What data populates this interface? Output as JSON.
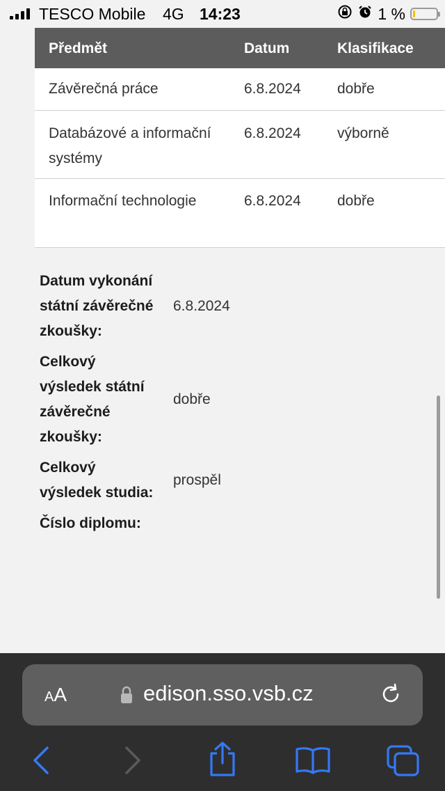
{
  "status_bar": {
    "carrier": "TESCO Mobile",
    "network": "4G",
    "time": "14:23",
    "battery_percent": "1 %",
    "battery_color": "#f3c300"
  },
  "grades_table": {
    "headers": [
      "Předmět",
      "Datum",
      "Klasifikace"
    ],
    "rows": [
      {
        "subject": "Závěrečná práce",
        "date": "6.8.2024",
        "grade": "dobře"
      },
      {
        "subject": "Databázové a informační systémy",
        "date": "6.8.2024",
        "grade": "výborně"
      },
      {
        "subject": "Informační technologie",
        "date": "6.8.2024",
        "grade": "dobře"
      }
    ]
  },
  "summary": [
    {
      "label": "Datum vykonání státní závěrečné zkoušky:",
      "value": "6.8.2024"
    },
    {
      "label": "Celkový výsledek státní závěrečné zkoušky:",
      "value": "dobře"
    },
    {
      "label": "Celkový výsledek studia:",
      "value": "prospěl"
    },
    {
      "label": "Číslo diplomu:",
      "value": ""
    }
  ],
  "browser": {
    "text_size_label_small": "A",
    "text_size_label_large": "A",
    "url": "edison.sso.vsb.cz",
    "lock_icon": "lock-icon",
    "reload_icon": "reload-icon",
    "toolbar_icons": [
      "back-icon",
      "forward-icon",
      "share-icon",
      "bookmarks-icon",
      "tabs-icon"
    ],
    "accent_color": "#3478f6"
  }
}
